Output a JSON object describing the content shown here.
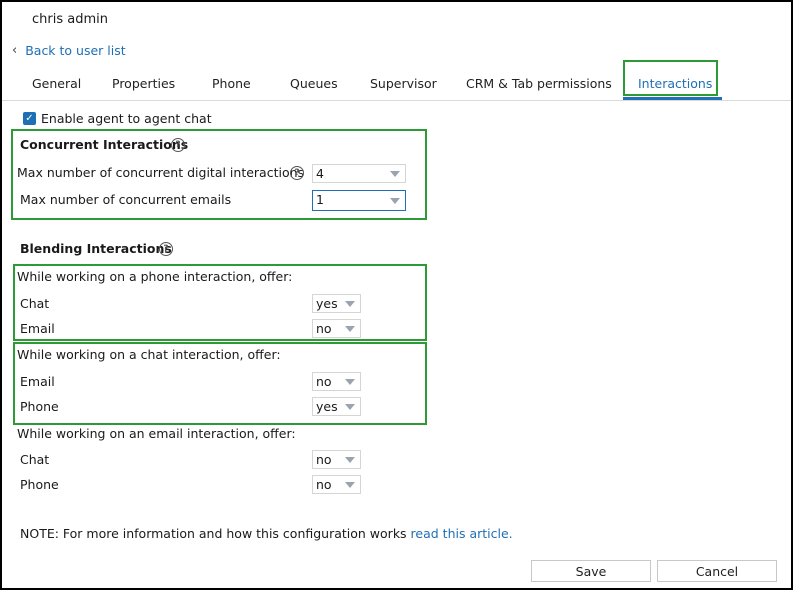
{
  "user": {
    "name": "chris admin"
  },
  "nav": {
    "back_label": "Back to user list"
  },
  "tabs": [
    {
      "label": "General"
    },
    {
      "label": "Properties"
    },
    {
      "label": "Phone"
    },
    {
      "label": "Queues"
    },
    {
      "label": "Supervisor"
    },
    {
      "label": "CRM & Tab permissions"
    },
    {
      "label": "Interactions"
    }
  ],
  "active_tab": "Interactions",
  "agent_chat": {
    "label": "Enable agent to agent chat",
    "checked": true
  },
  "concurrent": {
    "title": "Concurrent Interactions",
    "digital_label": "Max number of concurrent digital interactions",
    "digital_value": "4",
    "emails_label": "Max number of concurrent emails",
    "emails_value": "1"
  },
  "blending": {
    "title": "Blending Interactions",
    "phone_group": {
      "heading": "While working on a phone interaction, offer:",
      "rows": [
        {
          "label": "Chat",
          "value": "yes"
        },
        {
          "label": "Email",
          "value": "no"
        }
      ]
    },
    "chat_group": {
      "heading": "While working on a chat interaction, offer:",
      "rows": [
        {
          "label": "Email",
          "value": "no"
        },
        {
          "label": "Phone",
          "value": "yes"
        }
      ]
    },
    "email_group": {
      "heading": "While working on an email interaction, offer:",
      "rows": [
        {
          "label": "Chat",
          "value": "no"
        },
        {
          "label": "Phone",
          "value": "no"
        }
      ]
    }
  },
  "note": {
    "text": "NOTE: For more information and how this configuration works ",
    "link": "read this article."
  },
  "buttons": {
    "save": "Save",
    "cancel": "Cancel"
  },
  "colors": {
    "accent": "#1f6fb5",
    "highlight": "#2e9a35"
  }
}
